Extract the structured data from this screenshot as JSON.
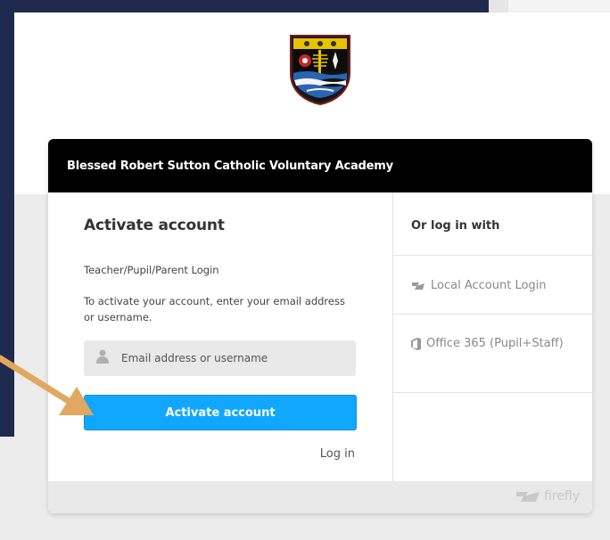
{
  "header": {
    "school_name": "Blessed Robert Sutton Catholic Voluntary Academy"
  },
  "form": {
    "title": "Activate account",
    "login_type": "Teacher/Pupil/Parent Login",
    "instructions": "To activate your account, enter your email address or username.",
    "input_placeholder": "Email address or username",
    "submit_label": "Activate account",
    "login_link": "Log in"
  },
  "alt_login": {
    "heading": "Or log in with",
    "providers": [
      {
        "label": "Local Account Login",
        "icon": "firefly-icon"
      },
      {
        "label": "Office 365 (Pupil+Staff)",
        "icon": "office-icon"
      }
    ]
  },
  "footer": {
    "brand": "firefly"
  },
  "colors": {
    "navy": "#1e2b4e",
    "button": "#11a7ff",
    "arrow": "#e0a860"
  }
}
